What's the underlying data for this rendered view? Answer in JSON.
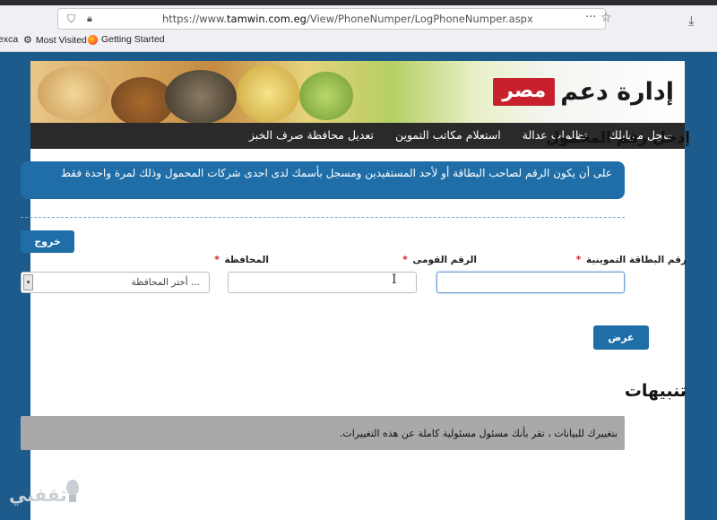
{
  "browser": {
    "url_prefix": "https://www.",
    "url_host": "tamwin.com.eg",
    "url_path": "/View/PhoneNumper/LogPhoneNumper.aspx",
    "bookmarks": [
      {
        "label": "exca",
        "icon": "folder-icon"
      },
      {
        "label": "Most Visited",
        "icon": "gear-icon"
      },
      {
        "label": "Getting Started",
        "icon": "firefox-icon"
      }
    ]
  },
  "logo": {
    "text": "إدارة دعم",
    "highlight": "مصر"
  },
  "nav": {
    "items": [
      "سجل موبايلك",
      "تظلمات عدالة",
      "استعلام مكاتب التموين",
      "تعديل محافظة صرف الخبز"
    ]
  },
  "form": {
    "title": "إدخل رقم المحمول",
    "notice": "على أن يكون الرقم لصاحب البطاقة أو لأحد المستفيدين ومسجل بأسمك لدى احدى شركات المحمول وذلك لمرة واحدة فقط",
    "exit_label": "خروج",
    "card_label": "رقم البطاقة التموينية",
    "nid_label": "الرقم القومى",
    "gov_label": "المحافظة",
    "required_mark": "*",
    "card_value": "",
    "nid_value": "",
    "gov_selected": "... أختر المحافظة",
    "show_label": "عرض"
  },
  "alerts": {
    "title": "تنبيهات",
    "text": "بتغييرك للبيانات ، تقر بأنك مسئول مسئولية كاملة عن هذه التغييرات."
  },
  "watermark": {
    "text": "ثقفني"
  },
  "colors": {
    "site_background": "#1d5b8c",
    "primary_blue": "#1f6ea8",
    "nav_background": "#2a2a2a",
    "logo_red": "#c8202c",
    "alert_gray": "#a9a9ab"
  }
}
